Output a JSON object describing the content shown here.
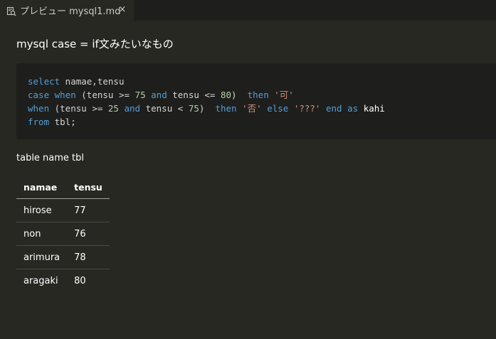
{
  "tab": {
    "title": "プレビュー mysql1.md",
    "icon": "preview-icon",
    "close_label": "×"
  },
  "doc": {
    "heading": "mysql case = if文みたいなもの",
    "code_lines": [
      [
        {
          "t": "select",
          "c": "kw"
        },
        {
          "t": " namae,tensu",
          "c": "plain"
        }
      ],
      [
        {
          "t": "case",
          "c": "kw"
        },
        {
          "t": " ",
          "c": "plain"
        },
        {
          "t": "when",
          "c": "kw"
        },
        {
          "t": " (tensu >= ",
          "c": "plain"
        },
        {
          "t": "75",
          "c": "num"
        },
        {
          "t": " ",
          "c": "plain"
        },
        {
          "t": "and",
          "c": "kw"
        },
        {
          "t": " tensu <= ",
          "c": "plain"
        },
        {
          "t": "80",
          "c": "num"
        },
        {
          "t": ")  ",
          "c": "plain"
        },
        {
          "t": "then",
          "c": "kw"
        },
        {
          "t": " ",
          "c": "plain"
        },
        {
          "t": "'可'",
          "c": "str"
        }
      ],
      [
        {
          "t": "when",
          "c": "kw"
        },
        {
          "t": " (tensu >= ",
          "c": "plain"
        },
        {
          "t": "25",
          "c": "num"
        },
        {
          "t": " ",
          "c": "plain"
        },
        {
          "t": "and",
          "c": "kw"
        },
        {
          "t": " tensu < ",
          "c": "plain"
        },
        {
          "t": "75",
          "c": "num"
        },
        {
          "t": ")  ",
          "c": "plain"
        },
        {
          "t": "then",
          "c": "kw"
        },
        {
          "t": " ",
          "c": "plain"
        },
        {
          "t": "'否'",
          "c": "str"
        },
        {
          "t": " ",
          "c": "plain"
        },
        {
          "t": "else",
          "c": "kw"
        },
        {
          "t": " ",
          "c": "plain"
        },
        {
          "t": "'???'",
          "c": "str"
        },
        {
          "t": " ",
          "c": "plain"
        },
        {
          "t": "end",
          "c": "kw"
        },
        {
          "t": " ",
          "c": "plain"
        },
        {
          "t": "as",
          "c": "kw"
        },
        {
          "t": " ",
          "c": "plain"
        },
        {
          "t": "kahi",
          "c": "alias"
        }
      ],
      [
        {
          "t": "from",
          "c": "kw"
        },
        {
          "t": " tbl;",
          "c": "plain"
        }
      ]
    ],
    "paragraph": "table name tbl",
    "table": {
      "headers": [
        "namae",
        "tensu"
      ],
      "rows": [
        [
          "hirose",
          "77"
        ],
        [
          "non",
          "76"
        ],
        [
          "arimura",
          "78"
        ],
        [
          "aragaki",
          "80"
        ]
      ]
    }
  },
  "colors": {
    "background": "#272822",
    "code_background": "#1e1f1c",
    "keyword": "#569cd6",
    "number": "#b5cea8",
    "string": "#ce9178"
  }
}
